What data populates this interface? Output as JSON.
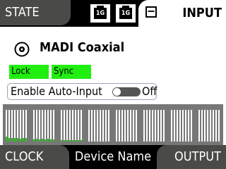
{
  "top": {
    "state_tab": "STATE",
    "io_icons": [
      {
        "icon": "ethernet-port-icon",
        "label": "1G"
      },
      {
        "icon": "ethernet-port-icon",
        "label": "1G"
      }
    ],
    "input_tab": "INPUT",
    "minus_icon": "minus-box-icon"
  },
  "main": {
    "source_icon": "coaxial-connector-icon",
    "source_title": "MADI Coaxial",
    "status_lock": "Lock",
    "status_sync": "Sync",
    "status_color": "#21ee11",
    "auto_input_label": "Enable Auto-Input",
    "auto_input_value": "Off",
    "meters": {
      "groups": 8,
      "channels_per_group": 8,
      "levels": [
        [
          0.15,
          0.12,
          0.1,
          0.12,
          0.1,
          0.08,
          0.1,
          0.12
        ],
        [
          0.06,
          0.08,
          0.06,
          0.08,
          0.06,
          0.08,
          0.06,
          0.06
        ],
        [
          0.04,
          0.04,
          0.04,
          0.04,
          0.04,
          0.04,
          0.04,
          0.04
        ],
        [
          0,
          0,
          0,
          0,
          0,
          0,
          0,
          0
        ],
        [
          0,
          0,
          0,
          0,
          0,
          0,
          0,
          0
        ],
        [
          0,
          0,
          0,
          0,
          0,
          0,
          0,
          0
        ],
        [
          0,
          0,
          0,
          0,
          0,
          0,
          0,
          0
        ],
        [
          0,
          0,
          0,
          0,
          0,
          0,
          0,
          0
        ]
      ],
      "meter_fill_color": "#21c811"
    }
  },
  "bottom": {
    "clock_tab": "CLOCK",
    "device_name": "Device Name",
    "output_tab": "OUTPUT"
  }
}
